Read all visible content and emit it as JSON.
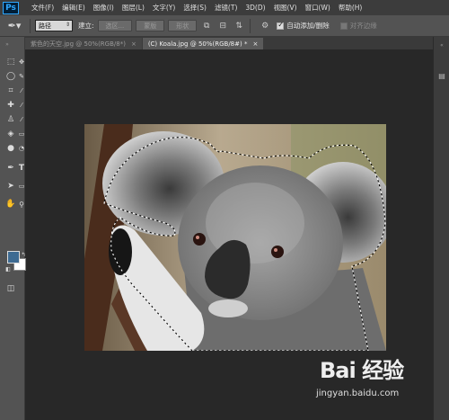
{
  "app": {
    "logo": "Ps"
  },
  "menu": [
    "文件(F)",
    "编辑(E)",
    "图像(I)",
    "图层(L)",
    "文字(Y)",
    "选择(S)",
    "滤镜(T)",
    "3D(D)",
    "视图(V)",
    "窗口(W)",
    "帮助(H)"
  ],
  "options": {
    "mode_value": "路径",
    "make_label": "建立:",
    "btn_selection": "选区...",
    "btn_mask": "蒙版",
    "btn_shape": "形状",
    "auto_add_label": "自动添加/删除",
    "auto_add_checked": true,
    "align_edges_label": "对齐边缘",
    "align_edges_checked": false
  },
  "tabs": [
    {
      "label": "紫色的天空.jpg @ 50%(RGB/8*)",
      "close": "×",
      "active": false
    },
    {
      "label": "(C) Koala.jpg @ 50%(RGB/8#) *",
      "close": "×",
      "active": true
    }
  ],
  "colors": {
    "foreground": "#3e6b92",
    "background": "#ffffff"
  },
  "watermark": {
    "logo": "Bai 经验",
    "url": "jingyan.baidu.com"
  }
}
